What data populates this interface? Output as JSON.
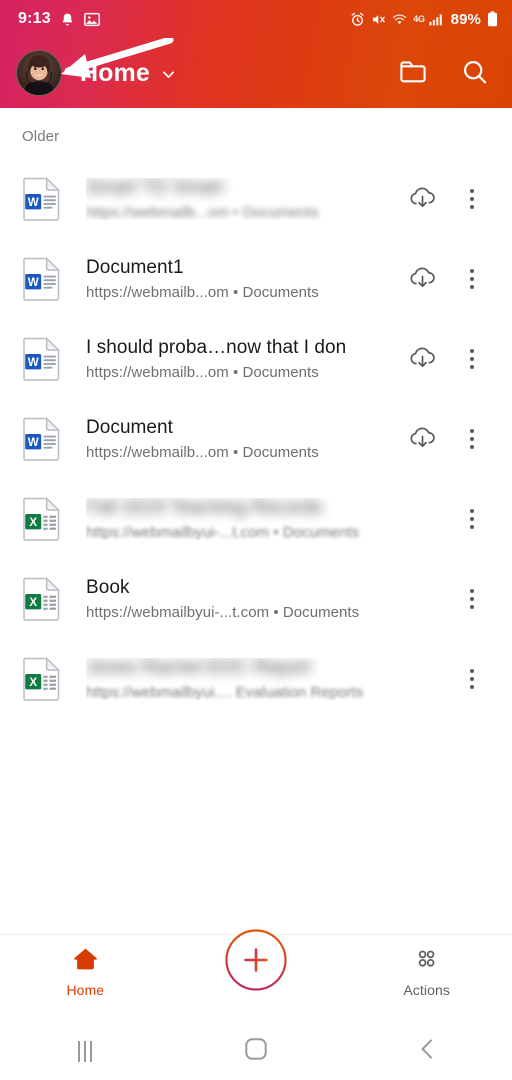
{
  "status_bar": {
    "time": "9:13",
    "left_icons": [
      "alarm-bell-icon",
      "photo-icon"
    ],
    "right_icons": [
      "alarm-clock-icon",
      "mute-icon",
      "wifi-icon",
      "mobile-signal-icon"
    ],
    "network_label": "4G",
    "battery_percent": "89%"
  },
  "header": {
    "avatar_name": "user-avatar",
    "title": "Home",
    "dropdown_icon": "chevron-down-icon",
    "folder_icon": "folder-icon",
    "search_icon": "search-icon",
    "annotation": "arrow-pointing-to-avatar",
    "accent_start": "#d62263",
    "accent_end": "#d94404"
  },
  "content": {
    "section_label": "Older",
    "files": [
      {
        "title": "Smart TD Smart",
        "subtitle_url": "https://webmailb...om",
        "subtitle_location": "Documents",
        "separator": "•",
        "file_type": "word",
        "icon": "word-file-icon",
        "blurred_title": true,
        "blurred_subtitle": true,
        "has_cloud_action": true,
        "cloud_icon": "cloud-download-icon",
        "overflow_icon": "more-vertical-icon"
      },
      {
        "title": "Document1",
        "subtitle_url": "https://webmailb...om",
        "subtitle_location": "Documents",
        "separator": "•",
        "file_type": "word",
        "icon": "word-file-icon",
        "blurred_title": false,
        "blurred_subtitle": false,
        "has_cloud_action": true,
        "cloud_icon": "cloud-download-icon",
        "overflow_icon": "more-vertical-icon"
      },
      {
        "title": "I should proba…now that I don",
        "subtitle_url": "https://webmailb...om",
        "subtitle_location": "Documents",
        "separator": "•",
        "file_type": "word",
        "icon": "word-file-icon",
        "blurred_title": false,
        "blurred_subtitle": false,
        "has_cloud_action": true,
        "cloud_icon": "cloud-download-icon",
        "overflow_icon": "more-vertical-icon"
      },
      {
        "title": "Document",
        "subtitle_url": "https://webmailb...om",
        "subtitle_location": "Documents",
        "separator": "•",
        "file_type": "word",
        "icon": "word-file-icon",
        "blurred_title": false,
        "blurred_subtitle": false,
        "has_cloud_action": true,
        "cloud_icon": "cloud-download-icon",
        "overflow_icon": "more-vertical-icon"
      },
      {
        "title": "Fall 2019 Teaching Records",
        "subtitle_url": "https://webmailbyui-...t.com",
        "subtitle_location": "Documents",
        "separator": "•",
        "file_type": "excel",
        "icon": "excel-file-icon",
        "blurred_title": true,
        "blurred_subtitle": true,
        "has_cloud_action": false,
        "cloud_icon": "",
        "overflow_icon": "more-vertical-icon"
      },
      {
        "title": "Book",
        "subtitle_url": "https://webmailbyui-...t.com",
        "subtitle_location": "Documents",
        "separator": "•",
        "file_type": "excel",
        "icon": "excel-file-icon",
        "blurred_title": false,
        "blurred_subtitle": false,
        "has_cloud_action": false,
        "cloud_icon": "",
        "overflow_icon": "more-vertical-icon"
      },
      {
        "title": "Jones Rachel EOC Report",
        "subtitle_url": "https://webmailbyui....",
        "subtitle_location": "Evaluation Reports",
        "separator": "",
        "file_type": "excel",
        "icon": "excel-file-icon",
        "blurred_title": true,
        "blurred_subtitle": true,
        "has_cloud_action": false,
        "cloud_icon": "",
        "overflow_icon": "more-vertical-icon"
      }
    ]
  },
  "bottom_nav": {
    "home_label": "Home",
    "home_icon": "home-icon",
    "create_icon": "plus-icon",
    "actions_label": "Actions",
    "actions_icon": "grid-dots-icon",
    "active_color": "#d83b01"
  },
  "android_nav": {
    "recents_icon": "recents-icon",
    "home_icon": "android-home-icon",
    "back_icon": "back-icon"
  }
}
